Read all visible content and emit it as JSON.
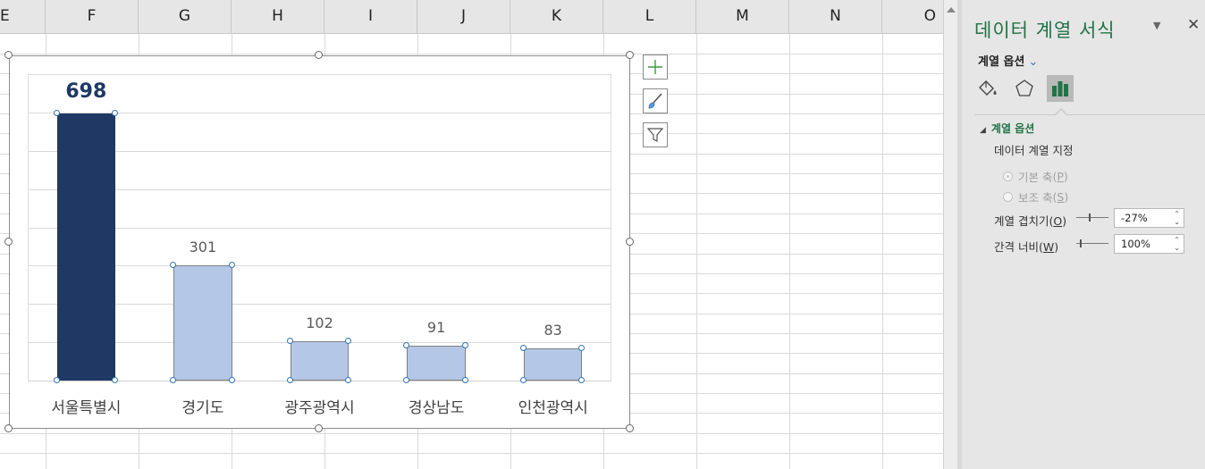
{
  "sheet": {
    "columns": [
      "E",
      "F",
      "G",
      "H",
      "I",
      "J",
      "K",
      "L",
      "M",
      "N",
      "O"
    ]
  },
  "chart_data": {
    "type": "bar",
    "categories": [
      "서울특별시",
      "경기도",
      "광주광역시",
      "경상남도",
      "인천광역시"
    ],
    "values": [
      698,
      301,
      102,
      91,
      83
    ],
    "title": "",
    "xlabel": "",
    "ylabel": "",
    "ylim": [
      0,
      800
    ],
    "grid": true,
    "legend": "none",
    "highlight_index": 0,
    "colors": {
      "highlight": "#1f3864",
      "normal": "#b4c7e7"
    }
  },
  "chart_buttons": {
    "elements": "chart-elements-plus-icon",
    "styles": "chart-styles-brush-icon",
    "filters": "chart-filters-funnel-icon"
  },
  "pane": {
    "title": "데이터 계열 서식",
    "options_dropdown": "계열 옵션",
    "section_title": "계열 옵션",
    "plot_series_on": "데이터 계열 지정",
    "primary_axis": {
      "label": "기본 축",
      "key": "P"
    },
    "secondary_axis": {
      "label": "보조 축",
      "key": "S"
    },
    "overlap": {
      "label": "계열 겹치기",
      "key": "O",
      "value": "-27%"
    },
    "gap_width": {
      "label": "간격 너비",
      "key": "W",
      "value": "100%"
    },
    "accent": "#217346"
  }
}
